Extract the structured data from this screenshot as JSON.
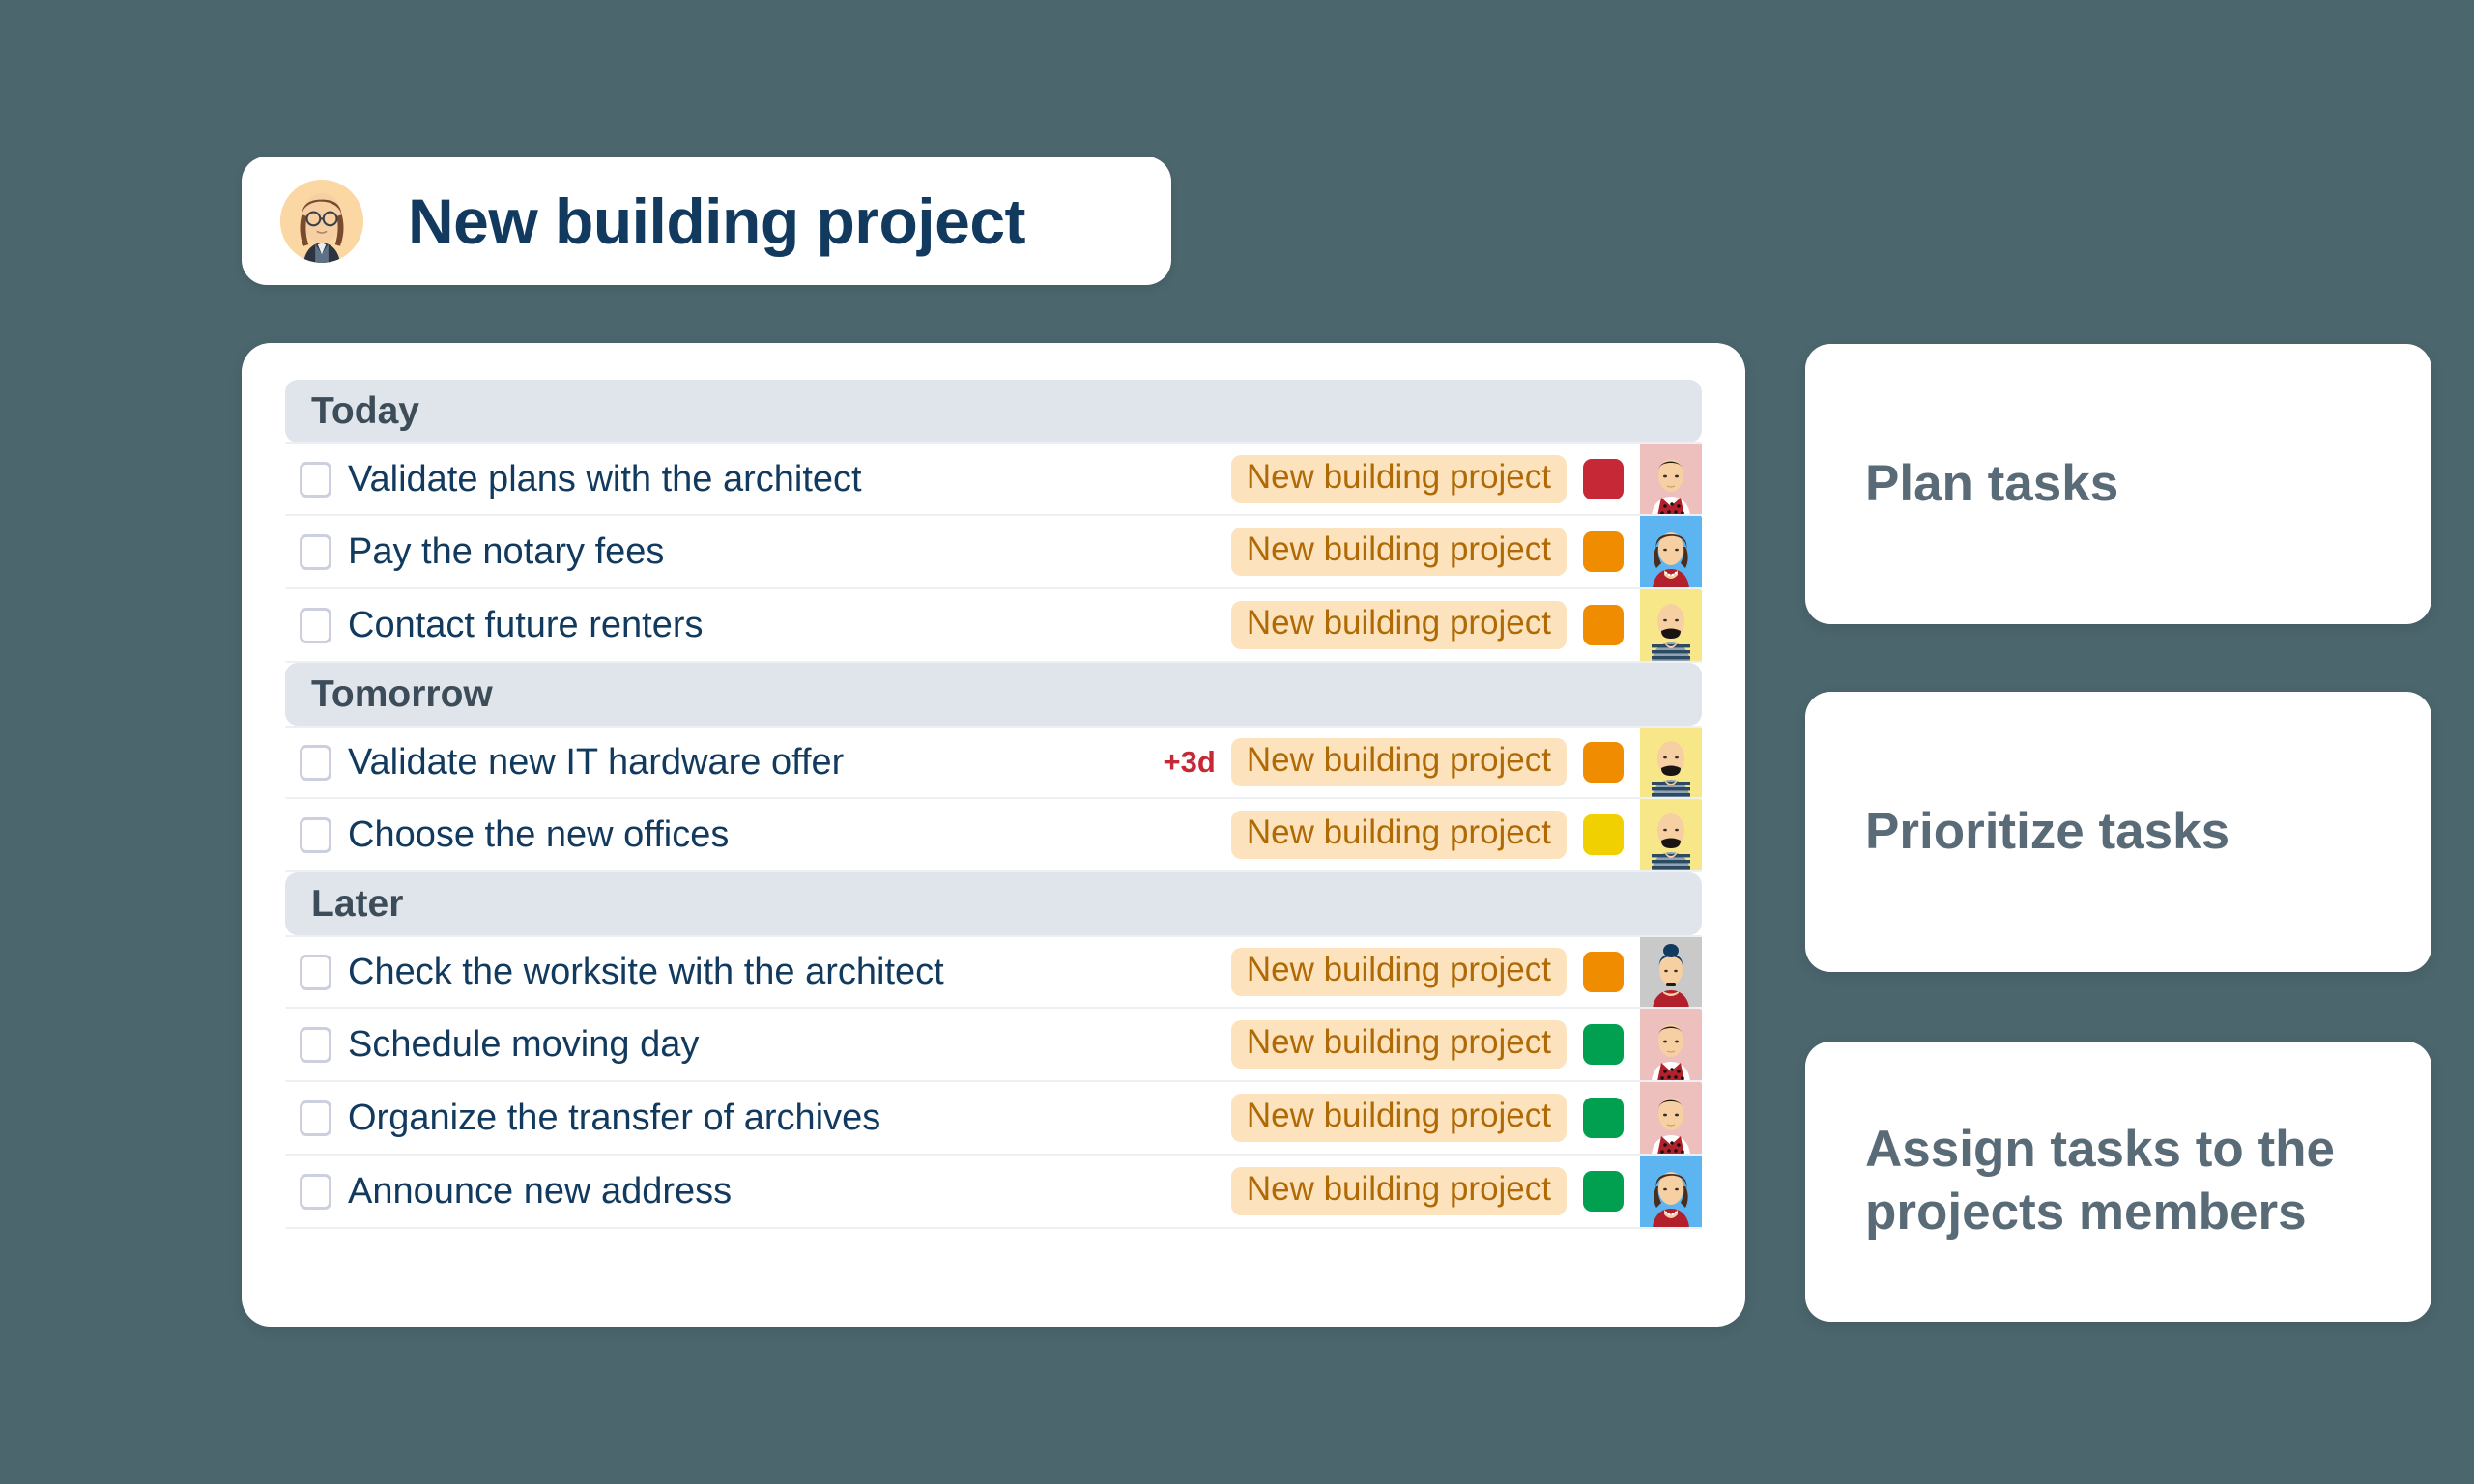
{
  "header": {
    "title": "New building project",
    "avatar": "woman-with-glasses-avatar"
  },
  "colors": {
    "page_background": "#4c666e",
    "card_background": "#ffffff",
    "title_text": "#123a5e",
    "group_header_background": "#e0e5ec",
    "group_header_text": "#3d4c59",
    "project_tag_background": "#fce3bd",
    "project_tag_text": "#b06a05",
    "due_badge_text": "#c62836",
    "feature_text": "#5a6b78",
    "chip_red": "#c62836",
    "chip_orange": "#f08c00",
    "chip_yellow": "#f0d000",
    "chip_green": "#00a050"
  },
  "task_list": {
    "groups": [
      {
        "label": "Today",
        "tasks": [
          {
            "title": "Validate plans with the architect",
            "checked": false,
            "due_badge": "",
            "project": "New building project",
            "priority_color": "#c62836",
            "priority_name": "red",
            "assignee": "man-patterned-vest-avatar",
            "assignee_background": "#eec0bd"
          },
          {
            "title": "Pay the notary fees",
            "checked": false,
            "due_badge": "",
            "project": "New building project",
            "priority_color": "#f08c00",
            "priority_name": "orange",
            "assignee": "woman-red-top-avatar",
            "assignee_background": "#5cb4f0"
          },
          {
            "title": "Contact future renters",
            "checked": false,
            "due_badge": "",
            "project": "New building project",
            "priority_color": "#f08c00",
            "priority_name": "orange",
            "assignee": "bald-man-mustache-avatar",
            "assignee_background": "#f7e789"
          }
        ]
      },
      {
        "label": "Tomorrow",
        "tasks": [
          {
            "title": "Validate new IT hardware offer",
            "checked": false,
            "due_badge": "+3d",
            "project": "New building project",
            "priority_color": "#f08c00",
            "priority_name": "orange",
            "assignee": "bald-man-mustache-avatar",
            "assignee_background": "#f7e789"
          },
          {
            "title": "Choose the new offices",
            "checked": false,
            "due_badge": "",
            "project": "New building project",
            "priority_color": "#f0d000",
            "priority_name": "yellow",
            "assignee": "bald-man-mustache-avatar",
            "assignee_background": "#f7e789"
          }
        ]
      },
      {
        "label": "Later",
        "tasks": [
          {
            "title": "Check the worksite with the architect",
            "checked": false,
            "due_badge": "",
            "project": "New building project",
            "priority_color": "#f08c00",
            "priority_name": "orange",
            "assignee": "woman-blue-bun-avatar",
            "assignee_background": "#c9c9c9"
          },
          {
            "title": "Schedule moving day",
            "checked": false,
            "due_badge": "",
            "project": "New building project",
            "priority_color": "#00a050",
            "priority_name": "green",
            "assignee": "man-patterned-vest-avatar",
            "assignee_background": "#eec0bd"
          },
          {
            "title": "Organize the transfer of archives",
            "checked": false,
            "due_badge": "",
            "project": "New building project",
            "priority_color": "#00a050",
            "priority_name": "green",
            "assignee": "man-patterned-vest-avatar",
            "assignee_background": "#eec0bd"
          },
          {
            "title": "Announce new address",
            "checked": false,
            "due_badge": "",
            "project": "New building project",
            "priority_color": "#00a050",
            "priority_name": "green",
            "assignee": "woman-red-top-avatar",
            "assignee_background": "#5cb4f0"
          }
        ]
      }
    ]
  },
  "features": [
    {
      "label": "Plan tasks"
    },
    {
      "label": "Prioritize tasks"
    },
    {
      "label": "Assign tasks to the projects members"
    }
  ]
}
